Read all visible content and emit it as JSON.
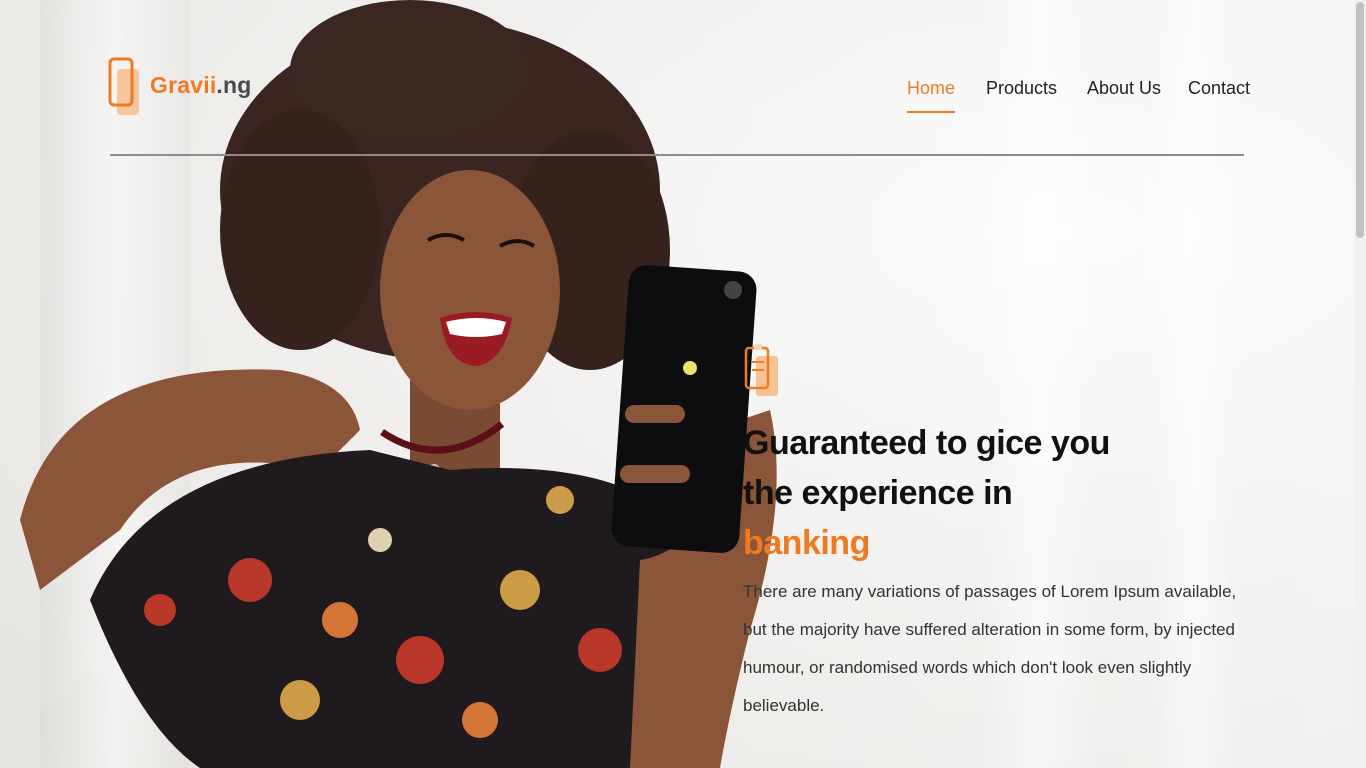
{
  "brand": {
    "name_primary": "Gravii",
    "name_suffix": ".ng",
    "accent_color": "#f07a23"
  },
  "nav": {
    "items": [
      {
        "label": "Home",
        "active": true
      },
      {
        "label": "Products",
        "active": false
      },
      {
        "label": "About Us",
        "active": false
      },
      {
        "label": "Contact",
        "active": false
      }
    ]
  },
  "hero": {
    "icon": "phone-layers-icon",
    "headline_line1": "Guaranteed to gice you",
    "headline_line2": "the experience in",
    "headline_accent": "banking",
    "body": "There are many variations of passages of Lorem Ipsum available, but the majority have suffered alteration in some form, by injected humour, or randomised words which don't look even slightly believable."
  }
}
